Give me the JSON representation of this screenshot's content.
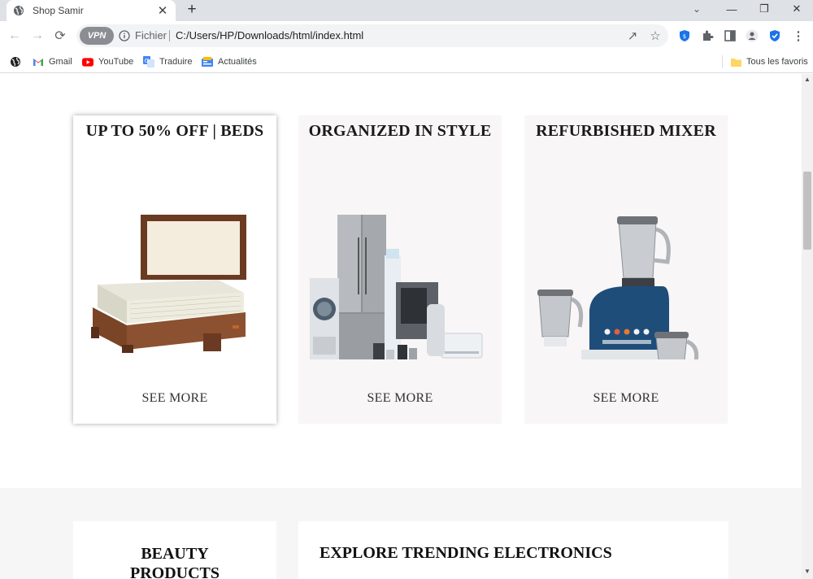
{
  "browser": {
    "tab_title": "Shop Samir",
    "scheme_label": "Fichier",
    "url": "C:/Users/HP/Downloads/html/index.html",
    "vpn_label": "VPN",
    "bookmarks": [
      {
        "label": "Gmail",
        "icon": "gmail-icon"
      },
      {
        "label": "YouTube",
        "icon": "youtube-icon"
      },
      {
        "label": "Traduire",
        "icon": "translate-icon"
      },
      {
        "label": "Actualités",
        "icon": "news-icon"
      }
    ],
    "all_bookmarks_label": "Tous les favoris"
  },
  "promo_cards": [
    {
      "title": "UP TO 50% OFF | BEDS",
      "link": "SEE MORE",
      "image": "bed-image"
    },
    {
      "title": "ORGANIZED IN STYLE",
      "link": "SEE MORE",
      "image": "appliances-image"
    },
    {
      "title": "REFURBISHED MIXER",
      "link": "SEE MORE",
      "image": "mixer-image"
    }
  ],
  "section2": {
    "beauty_title": "BEAUTY PRODUCTS",
    "electronics_title": "EXPLORE TRENDING ELECTRONICS"
  },
  "colors": {
    "card_bg": "#f8f6f6",
    "section_bg": "#f6f6f6",
    "shield_blue": "#1a73e8"
  }
}
